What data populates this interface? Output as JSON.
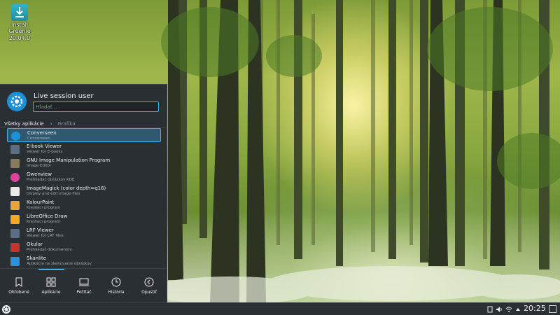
{
  "desktop": {
    "icon": {
      "label_line1": "Install Greenie",
      "label_line2": "20.04.0",
      "icon_name": "download-icon"
    }
  },
  "launcher": {
    "user_name": "Live session user",
    "search_placeholder": "Hľadať...",
    "breadcrumbs": [
      "Všetky aplikácie",
      "Grafika"
    ],
    "apps": [
      {
        "name": "Converseen",
        "desc": "Converseen",
        "icon": "converseen-icon",
        "color": "#1d90d6"
      },
      {
        "name": "E-book Viewer",
        "desc": "Viewer for E-books",
        "icon": "ebook-viewer-icon",
        "color": "#5a6e86"
      },
      {
        "name": "GNU Image Manipulation Program",
        "desc": "Image Editor",
        "icon": "gimp-icon",
        "color": "#8a7a5c"
      },
      {
        "name": "Gwenview",
        "desc": "Prehliadač obrázkov KDE",
        "icon": "gwenview-icon",
        "color": "#e0429b"
      },
      {
        "name": "ImageMagick (color depth=q16)",
        "desc": "Display and edit image files",
        "icon": "imagemagick-icon",
        "color": "#e9e9e9"
      },
      {
        "name": "KolourPaint",
        "desc": "Kresliaci program",
        "icon": "kolourpaint-icon",
        "color": "#e8a43c"
      },
      {
        "name": "LibreOffice Draw",
        "desc": "Kresliaci program",
        "icon": "libreoffice-draw-icon",
        "color": "#f5a623"
      },
      {
        "name": "LRF Viewer",
        "desc": "Viewer for LRF files",
        "icon": "lrf-viewer-icon",
        "color": "#5a6e86"
      },
      {
        "name": "Okular",
        "desc": "Prehliadač dokumentov",
        "icon": "okular-icon",
        "color": "#c9312e"
      },
      {
        "name": "Skanlite",
        "desc": "Aplikácia na skenovanie obrázkov",
        "icon": "skanlite-icon",
        "color": "#2f8fd8"
      }
    ],
    "tabs": [
      {
        "label": "Obľúbené",
        "icon": "bookmark-icon"
      },
      {
        "label": "Aplikácie",
        "icon": "grid-icon"
      },
      {
        "label": "Počítač",
        "icon": "computer-icon"
      },
      {
        "label": "História",
        "icon": "history-icon"
      },
      {
        "label": "Opustiť",
        "icon": "leave-icon"
      }
    ],
    "active_tab": "Aplikácie"
  },
  "taskbar": {
    "clock": "20:25",
    "tray_icons": [
      "clipboard-icon",
      "volume-icon",
      "network-icon",
      "expand-tray-icon"
    ]
  },
  "colors": {
    "accent": "#3daee9",
    "panel": "#2a2f33",
    "taskbar": "#2b3034"
  }
}
